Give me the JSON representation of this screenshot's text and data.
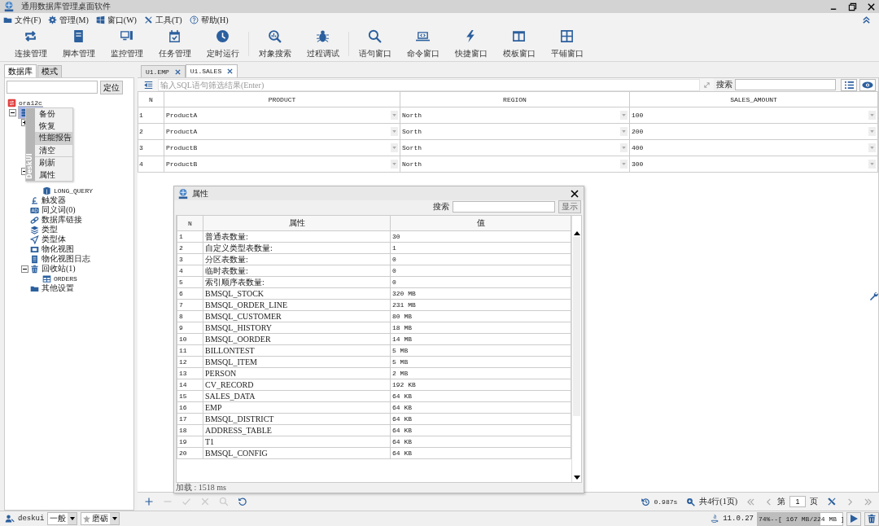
{
  "window": {
    "title": "通用数据库管理桌面软件"
  },
  "menu": [
    {
      "label": "文件(F)",
      "kind": "folder"
    },
    {
      "label": "管理(M)",
      "kind": "gear"
    },
    {
      "label": "窗口(W)",
      "kind": "windows"
    },
    {
      "label": "工具(T)",
      "kind": "tools"
    },
    {
      "label": "帮助(H)",
      "kind": "help"
    }
  ],
  "toolbar": [
    [
      {
        "label": "连接管理",
        "kind": "cycle"
      },
      {
        "label": "脚本管理",
        "kind": "book"
      },
      {
        "label": "监控管理",
        "kind": "monitor"
      },
      {
        "label": "任务管理",
        "kind": "calendar"
      },
      {
        "label": "定时运行",
        "kind": "clock"
      }
    ],
    [
      {
        "label": "对象搜索",
        "kind": "chart-search"
      },
      {
        "label": "过程调试",
        "kind": "bug"
      }
    ],
    [
      {
        "label": "语句窗口",
        "kind": "search"
      },
      {
        "label": "命令窗口",
        "kind": "laptop"
      },
      {
        "label": "快捷窗口",
        "kind": "bolt"
      },
      {
        "label": "模板窗口",
        "kind": "columns"
      },
      {
        "label": "平铺窗口",
        "kind": "grid"
      }
    ]
  ],
  "left_tabs": [
    {
      "label": "数据库",
      "selected": true
    },
    {
      "label": "模式",
      "selected": false
    }
  ],
  "locate_button": "定位",
  "tree": [
    {
      "label": "ora12c",
      "kind": "server",
      "selected": false,
      "children": [
        {
          "kind": "database",
          "selected": true,
          "expanded": true,
          "children": [
            {
              "expanded": false
            },
            {
              "expanded": true,
              "children": [
                {
                  "label": "LONG_QUERY",
                  "kind": "package"
                }
              ]
            },
            {
              "label": "触发器",
              "kind": "trigger"
            },
            {
              "label": "同义词(0)",
              "kind": "synonym"
            },
            {
              "label": "数据库链接",
              "kind": "link"
            },
            {
              "label": "类型",
              "kind": "layers"
            },
            {
              "label": "类型体",
              "kind": "send"
            },
            {
              "label": "物化视图",
              "kind": "film"
            },
            {
              "label": "物化视图日志",
              "kind": "log"
            },
            {
              "label": "回收站(1)",
              "kind": "trash",
              "expanded": true,
              "children": [
                {
                  "label": "ORDERS",
                  "kind": "table"
                }
              ]
            },
            {
              "label": "其他设置",
              "kind": "folder"
            }
          ]
        }
      ]
    }
  ],
  "context_menu": {
    "side_label": "DeskUI",
    "items": [
      {
        "label": "备份",
        "selected": false
      },
      {
        "label": "恢复",
        "selected": false
      },
      {
        "label": "性能报告",
        "selected": true
      },
      {
        "label": "清空",
        "selected": false
      },
      {
        "label": "刷新",
        "selected": false
      },
      {
        "label": "属性",
        "selected": false
      }
    ]
  },
  "editor_tabs": [
    {
      "label": "U1.EMP",
      "selected": false
    },
    {
      "label": "U1.SALES",
      "selected": true
    }
  ],
  "filter": {
    "placeholder": "输入SQL语句筛选结果(Enter)",
    "search_label": "搜索"
  },
  "table": {
    "columns": [
      "N",
      "PRODUCT",
      "REGION",
      "SALES_AMOUNT"
    ],
    "rows": [
      [
        "1",
        "ProductA",
        "North",
        "100"
      ],
      [
        "2",
        "ProductA",
        "Sorth",
        "200"
      ],
      [
        "3",
        "ProductB",
        "Sorth",
        "400"
      ],
      [
        "4",
        "ProductB",
        "North",
        "300"
      ]
    ]
  },
  "dialog": {
    "title": "属性",
    "search_label": "搜索",
    "show_button": "显示",
    "columns": [
      "N",
      "属性",
      "值"
    ],
    "rows": [
      [
        "1",
        "普通表数量:",
        "30"
      ],
      [
        "2",
        "自定义类型表数量:",
        "1"
      ],
      [
        "3",
        "分区表数量:",
        "0"
      ],
      [
        "4",
        "临时表数量:",
        "0"
      ],
      [
        "5",
        "索引顺序表数量:",
        "0"
      ],
      [
        "6",
        "BMSQL_STOCK",
        "320 MB"
      ],
      [
        "7",
        "BMSQL_ORDER_LINE",
        "231 MB"
      ],
      [
        "8",
        "BMSQL_CUSTOMER",
        "80 MB"
      ],
      [
        "9",
        "BMSQL_HISTORY",
        "18 MB"
      ],
      [
        "10",
        "BMSQL_OORDER",
        "14 MB"
      ],
      [
        "11",
        "BILLONTEST",
        "5 MB"
      ],
      [
        "12",
        "BMSQL_ITEM",
        "5 MB"
      ],
      [
        "13",
        "PERSON",
        "2 MB"
      ],
      [
        "14",
        "CV_RECORD",
        "192 KB"
      ],
      [
        "15",
        "SALES_DATA",
        "64 KB"
      ],
      [
        "16",
        "EMP",
        "64 KB"
      ],
      [
        "17",
        "BMSQL_DISTRICT",
        "64 KB"
      ],
      [
        "18",
        "ADDRESS_TABLE",
        "64 KB"
      ],
      [
        "19",
        "T1",
        "64 KB"
      ],
      [
        "20",
        "BMSQL_CONFIG",
        "64 KB"
      ]
    ],
    "footer": "加载 : 1518 ms"
  },
  "bottom_bar": {
    "actions": [
      {
        "kind": "add",
        "disabled": false
      },
      {
        "kind": "remove",
        "disabled": true
      },
      {
        "kind": "confirm",
        "disabled": true
      },
      {
        "kind": "cancel",
        "disabled": true
      },
      {
        "kind": "find",
        "disabled": true
      },
      {
        "kind": "refresh",
        "disabled": false
      }
    ],
    "time": "0.987s",
    "count": "共4行(1页)",
    "page_prefix": "第",
    "page": "1",
    "page_suffix": "页"
  },
  "status_bar": {
    "user": "deskui",
    "mode": "一般",
    "style": "磨砺",
    "version": "11.0.27",
    "memory": {
      "text": "74%--[ 167 MB/224 MB ]",
      "level": 0.74
    }
  }
}
